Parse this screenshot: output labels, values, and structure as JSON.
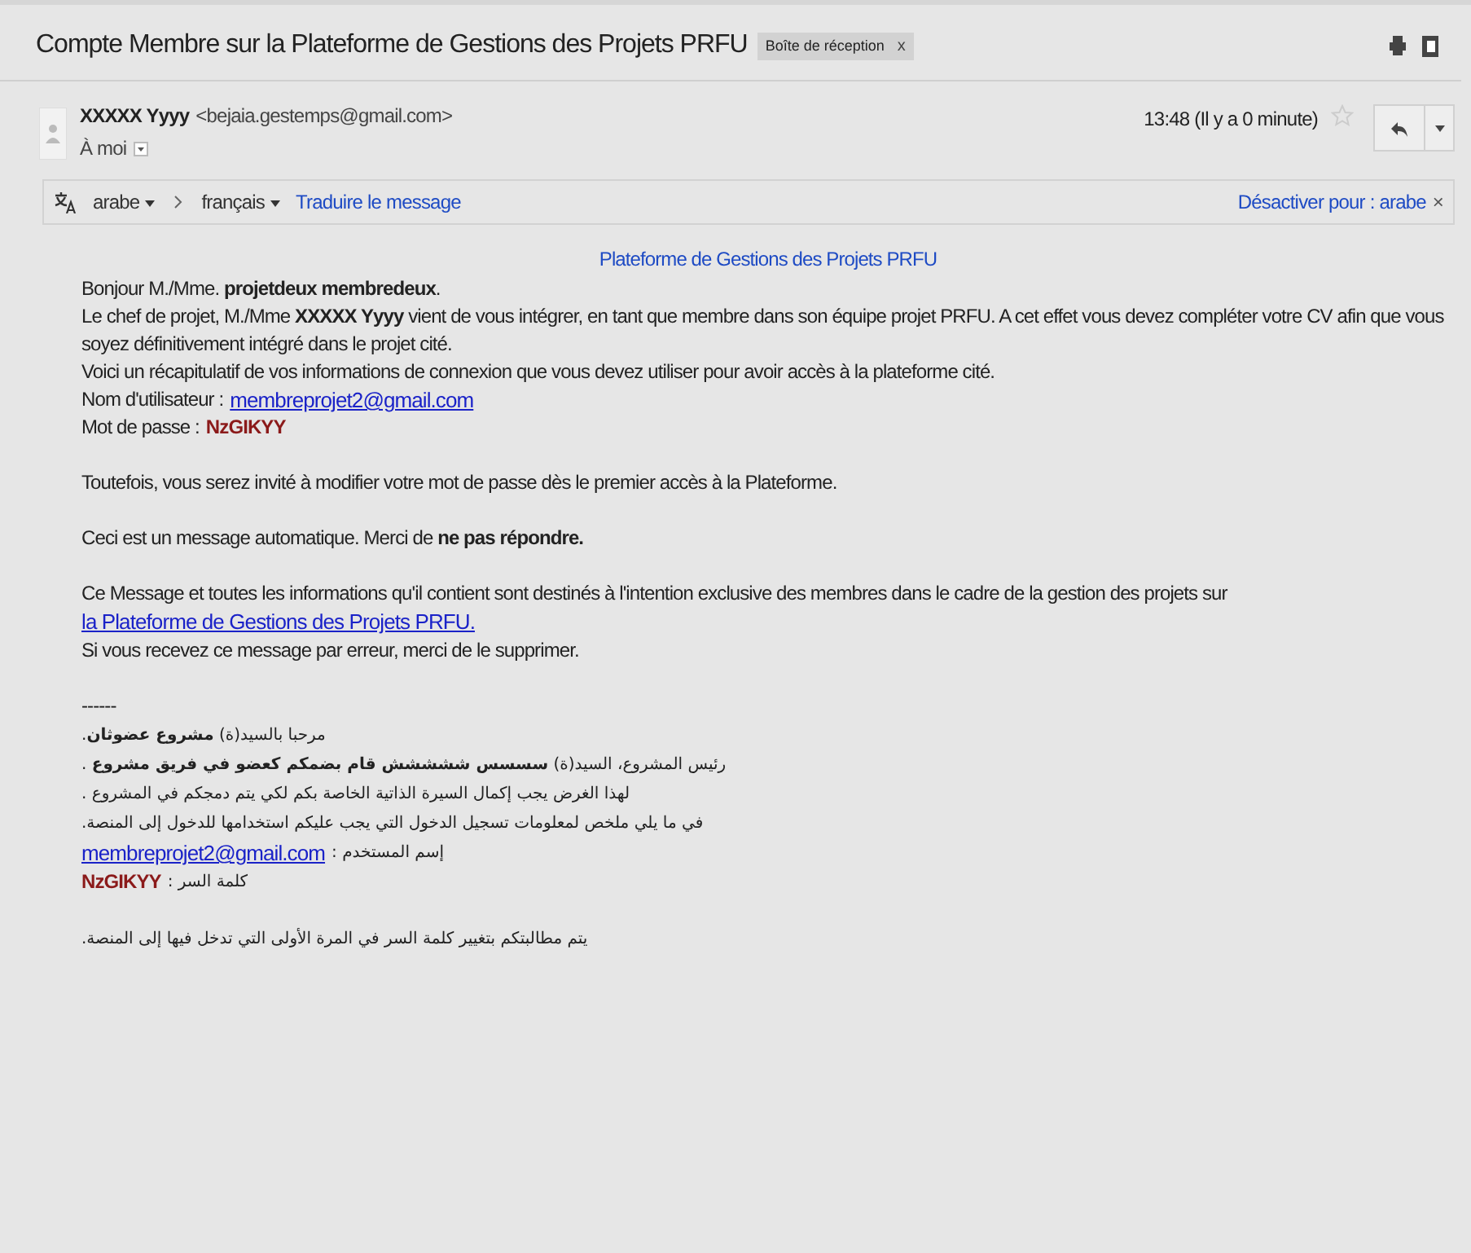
{
  "thread": {
    "subject": "Compte Membre sur la Plateforme de Gestions des Projets PRFU",
    "label": "Boîte de réception",
    "label_remove": "x"
  },
  "message": {
    "sender_name": "XXXXX Yyyy",
    "sender_email": "<bejaia.gestemps@gmail.com>",
    "recipient": "À moi",
    "time": "13:48 (Il y a 0 minute)",
    "starred": false
  },
  "translate_bar": {
    "source_language": "arabe",
    "target_language": "français",
    "translate_link": "Traduire le message",
    "disable_link": "Désactiver pour : arabe",
    "close": "×"
  },
  "body": {
    "heading_link": "Plateforme de Gestions des Projets PRFU",
    "blocks": [
      [
        {
          "kind": "text",
          "rtl": false,
          "text": "Bonjour M./Mme. **projetdeux membredeux**."
        },
        {
          "kind": "text",
          "rtl": false,
          "text": "Le chef de projet, M./Mme **XXXXX Yyyy** vient de vous intégrer, en tant que membre dans son équipe projet PRFU. A cet effet vous devez compléter votre CV afin que vous soyez définitivement intégré dans le projet cité."
        },
        {
          "kind": "text",
          "rtl": false,
          "text": "Voici un récapitulatif de vos informations de connexion que vous devez utiliser pour avoir accès à la plateforme cité."
        },
        {
          "kind": "link_field",
          "rtl": false,
          "label": "Nom d'utilisateur :",
          "value": "membreprojet2@gmail.com"
        },
        {
          "kind": "secret_field",
          "rtl": false,
          "label": "Mot de passe :",
          "value": "NzGIKYY"
        }
      ],
      [
        {
          "kind": "text",
          "rtl": false,
          "text": "Toutefois, vous serez invité à modifier votre mot de passe dès le premier accès à la Plateforme."
        }
      ],
      [
        {
          "kind": "text",
          "rtl": false,
          "text": "Ceci est un message automatique. Merci de **ne pas répondre.**"
        }
      ],
      [
        {
          "kind": "text_link",
          "text": "Ce Message et toutes les informations qu'il contient sont destinés à l'intention exclusive des membres dans le cadre de la gestion des projets sur",
          "link": "la Plateforme de Gestions des Projets PRFU."
        },
        {
          "kind": "text",
          "rtl": false,
          "text": "Si vous recevez ce message par erreur, merci de le supprimer."
        }
      ],
      [
        {
          "kind": "text",
          "rtl": false,
          "text": "------"
        },
        {
          "kind": "text",
          "rtl": true,
          "text": "مرحبا بالسيد(ة) **مشروع عضوثان**."
        },
        {
          "kind": "text",
          "rtl": true,
          "text": "رئيس المشروع، السيد(ة) **سسسس ششششش قام بضمكم كعضو في فريق مشروع** ."
        },
        {
          "kind": "text",
          "rtl": true,
          "text": "لهذا الغرض يجب إكمال السيرة الذاتية الخاصة بكم لكي يتم دمجكم في المشروع ."
        },
        {
          "kind": "text",
          "rtl": true,
          "text": "في ما يلي ملخص لمعلومات تسجيل الدخول التي يجب عليكم استخدامها للدخول إلى المنصة."
        },
        {
          "kind": "link_field",
          "rtl": true,
          "label": "إسم المستخدم :",
          "value": "membreprojet2@gmail.com"
        },
        {
          "kind": "secret_field",
          "rtl": true,
          "label": "كلمة السر :",
          "value": "NzGIKYY"
        }
      ],
      [
        {
          "kind": "text",
          "rtl": true,
          "text": "يتم مطالبتكم بتغيير كلمة السر في المرة الأولى التي تدخل فيها إلى المنصة."
        }
      ]
    ]
  }
}
